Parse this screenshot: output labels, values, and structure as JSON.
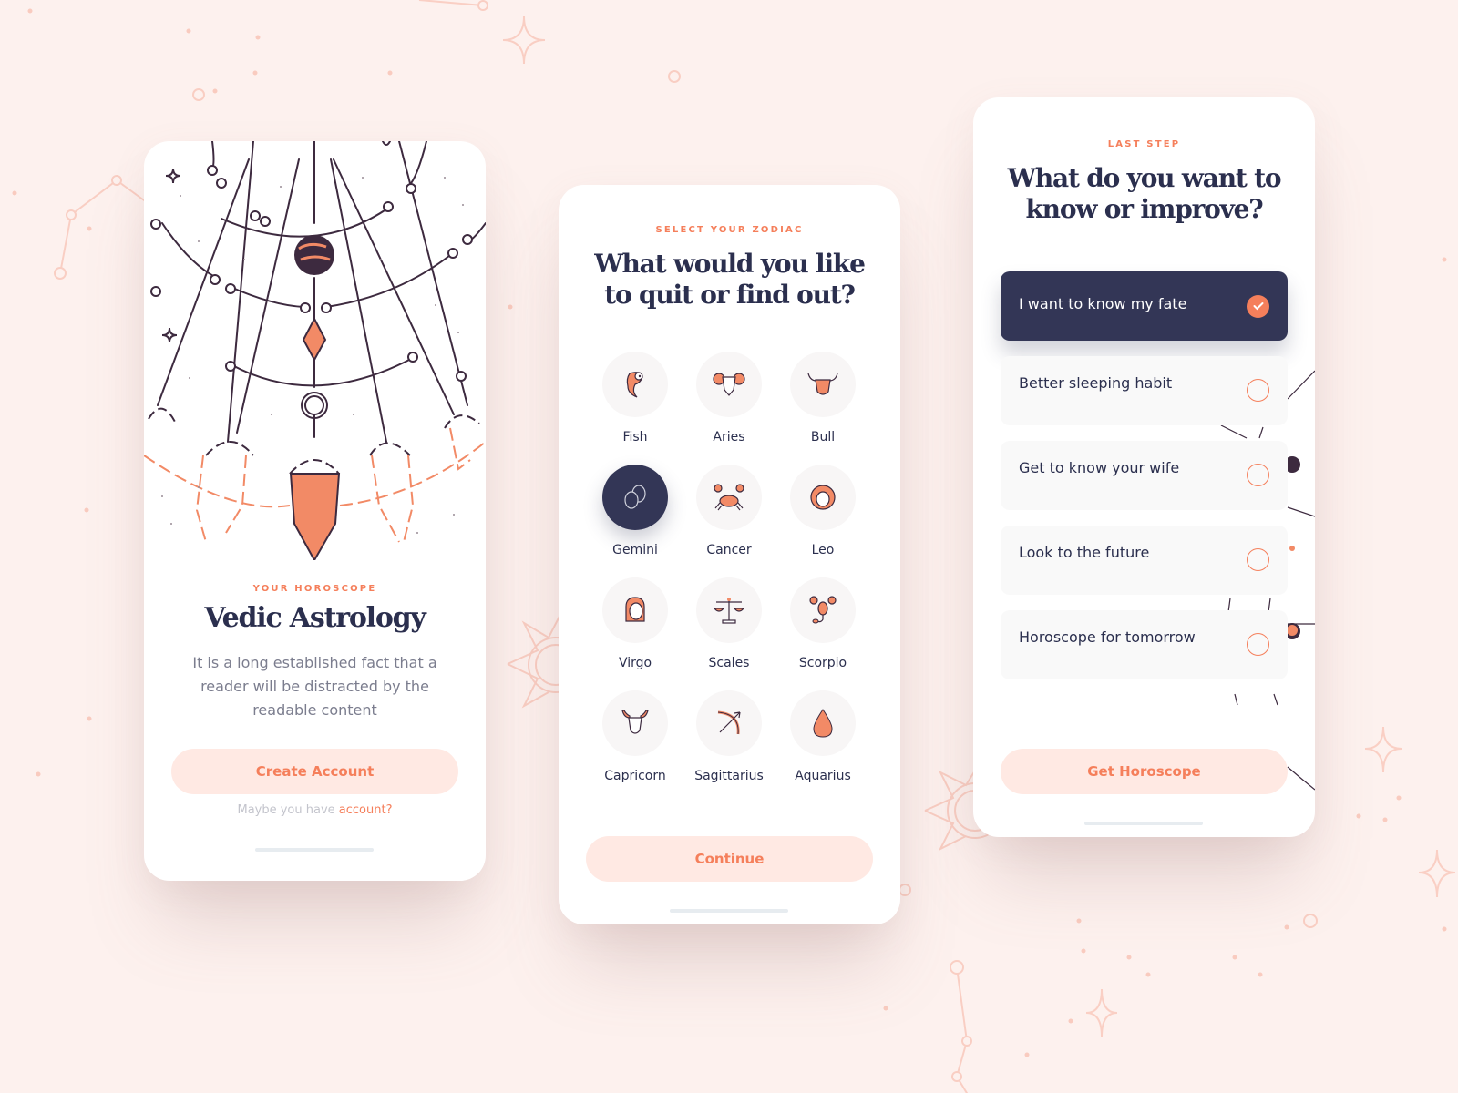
{
  "colors": {
    "background": "#fdf1ee",
    "accent": "#f57f5b",
    "accent_soft": "#ffe9e3",
    "navy": "#333656",
    "text_dark": "#2b2f4e",
    "text_muted": "#7b7d8e"
  },
  "screen1": {
    "illustration": "astrology-pendulum-illustration",
    "eyebrow": "YOUR HOROSCOPE",
    "title": "Vedic Astrology",
    "description": "It is a long established fact that a reader will be distracted by the readable content",
    "primary_button": "Create Account",
    "signin_prefix": "Maybe you have ",
    "signin_link": "account?"
  },
  "screen2": {
    "eyebrow": "SELECT YOUR ZODIAC",
    "title_line1": "What would you like",
    "title_line2": "to quit or find out?",
    "zodiacs": [
      {
        "label": "Fish",
        "icon": "fish-icon",
        "selected": false
      },
      {
        "label": "Aries",
        "icon": "ram-icon",
        "selected": false
      },
      {
        "label": "Bull",
        "icon": "bull-icon",
        "selected": false
      },
      {
        "label": "Gemini",
        "icon": "twins-icon",
        "selected": true
      },
      {
        "label": "Cancer",
        "icon": "crab-icon",
        "selected": false
      },
      {
        "label": "Leo",
        "icon": "lion-icon",
        "selected": false
      },
      {
        "label": "Virgo",
        "icon": "maiden-icon",
        "selected": false
      },
      {
        "label": "Scales",
        "icon": "scales-icon",
        "selected": false
      },
      {
        "label": "Scorpio",
        "icon": "scorpion-icon",
        "selected": false
      },
      {
        "label": "Capricorn",
        "icon": "goat-icon",
        "selected": false
      },
      {
        "label": "Sagittarius",
        "icon": "bow-arrow-icon",
        "selected": false
      },
      {
        "label": "Aquarius",
        "icon": "water-drop-icon",
        "selected": false
      }
    ],
    "primary_button": "Continue"
  },
  "screen3": {
    "eyebrow": "LAST STEP",
    "title_line1": "What do you want to",
    "title_line2": "know or improve?",
    "options": [
      {
        "label": "I want to know my fate",
        "selected": true
      },
      {
        "label": "Better sleeping habit",
        "selected": false
      },
      {
        "label": "Get to know your wife",
        "selected": false
      },
      {
        "label": "Look to the future",
        "selected": false
      },
      {
        "label": "Horoscope for tomorrow",
        "selected": false
      }
    ],
    "primary_button": "Get Horoscope"
  }
}
